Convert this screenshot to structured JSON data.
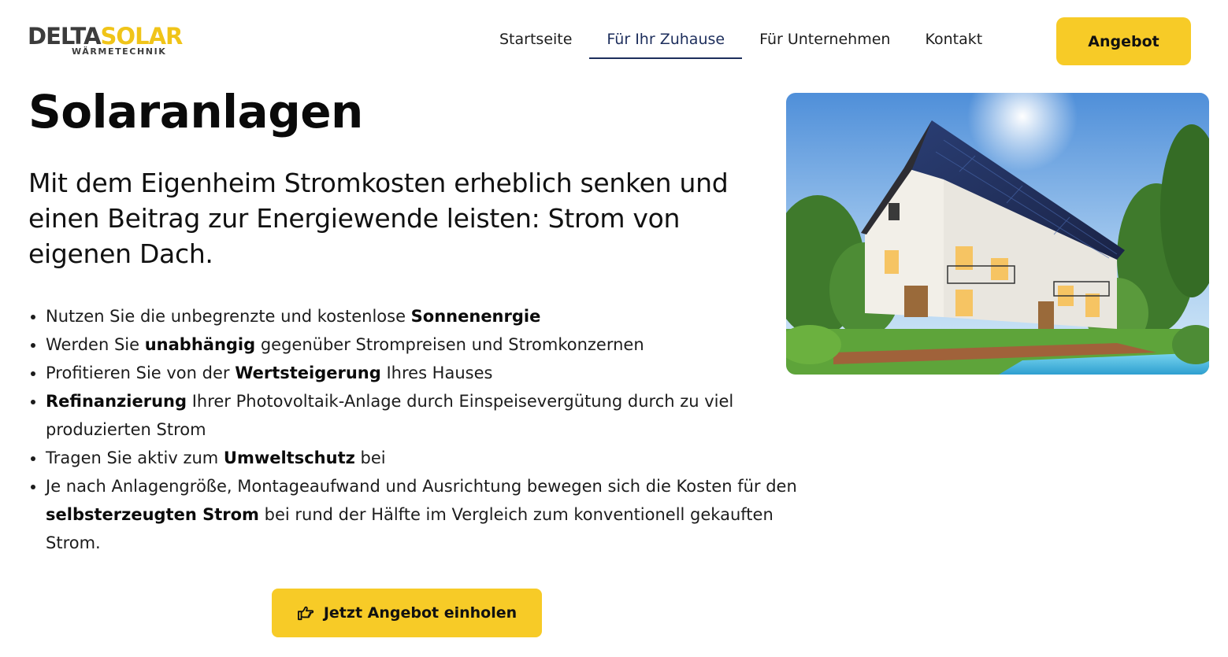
{
  "logo": {
    "word1": "DELTA",
    "word2": "SOLAR",
    "sub": "WÄRMETECHNIK"
  },
  "nav": {
    "items": [
      {
        "label": "Startseite"
      },
      {
        "label": "Für Ihr Zuhause"
      },
      {
        "label": "Für Unternehmen"
      },
      {
        "label": "Kontakt"
      }
    ],
    "active_index": 1
  },
  "header_cta": "Angebot",
  "page_title": "Solaranlagen",
  "lead": "Mit dem Eigenheim Stromkosten erheblich senken und einen Beitrag zur Energiewende leisten: Strom von eigenen Dach.",
  "benefits": [
    {
      "pre": "Nutzen Sie die unbegrenzte und kostenlose ",
      "bold": "Sonnenenrgie",
      "post": ""
    },
    {
      "pre": "Werden Sie ",
      "bold": "unabhängig",
      "post": " gegenüber Strompreisen und Stromkonzernen"
    },
    {
      "pre": "Profitieren Sie von der ",
      "bold": "Wertsteigerung",
      "post": " Ihres Hauses"
    },
    {
      "pre": "",
      "bold": "Refinanzierung",
      "post": " Ihrer Photovoltaik-Anlage durch Einspeisevergütung durch zu viel produzierten Strom"
    },
    {
      "pre": "Tragen Sie aktiv zum ",
      "bold": "Umweltschutz",
      "post": " bei"
    },
    {
      "pre": "Je nach Anlagengröße, Montageaufwand und Ausrichtung bewegen sich die Kosten für den ",
      "bold": "selbsterzeugten Strom",
      "post": " bei rund der Hälfte im Vergleich zum konventionell gekauften Strom."
    }
  ],
  "cta": {
    "label": "Jetzt Angebot einholen",
    "icon": "hand-pointing-right-icon"
  },
  "hero_image": {
    "subject": "house-with-solar-panels"
  },
  "colors": {
    "accent": "#f7cb27",
    "nav_active": "#1d2e5c",
    "text": "#111111"
  }
}
